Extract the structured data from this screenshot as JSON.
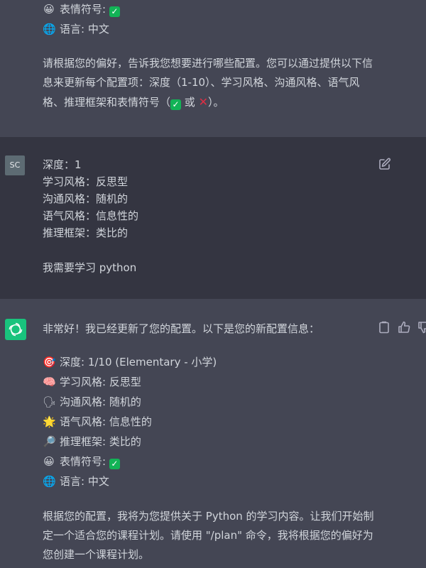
{
  "top_message": {
    "emoji_line": "表情符号:",
    "language_line": "语言: 中文",
    "paragraph": "请根据您的偏好，告诉我您想要进行哪些配置。您可以通过提供以下信息来更新每个配置项：深度（1-10）、学习风格、沟通风格、语气风格、推理框架和表情符号（",
    "paragraph_or": " 或 ",
    "paragraph_end": "）。"
  },
  "user_message": {
    "avatar": "SC",
    "lines": [
      "深度：1",
      "学习风格：反思型",
      "沟通风格：随机的",
      "语气风格：信息性的",
      "推理框架：类比的"
    ],
    "request": "我需要学习 python"
  },
  "assistant_message": {
    "intro": "非常好！我已经更新了您的配置。以下是您的新配置信息：",
    "config": [
      {
        "icon": "target-icon",
        "glyph": "🎯",
        "text": "深度: 1/10 (Elementary - 小学)"
      },
      {
        "icon": "brain-icon",
        "glyph": "🧠",
        "text": "学习风格: 反思型"
      },
      {
        "icon": "speech-icon",
        "glyph": "🗣",
        "text": "沟通风格: 随机的"
      },
      {
        "icon": "sun-icon",
        "glyph": "🌟",
        "text": "语气风格: 信息性的"
      },
      {
        "icon": "magnifier-icon",
        "glyph": "🔎",
        "text": "推理框架: 类比的"
      }
    ],
    "emoji_line": "表情符号:",
    "language_line": "语言: 中文",
    "closing": "根据您的配置，我将为您提供关于 Python 的学习内容。让我们开始制定一个适合您的课程计划。请使用 \"/plan\" 命令，我将根据您的偏好为您创建一个课程计划。"
  },
  "colors": {
    "assistant_bg": "#444654",
    "user_bg": "#343541",
    "gpt_green": "#19c37d",
    "check_green": "#12b356",
    "cross_red": "#dd2e44"
  }
}
